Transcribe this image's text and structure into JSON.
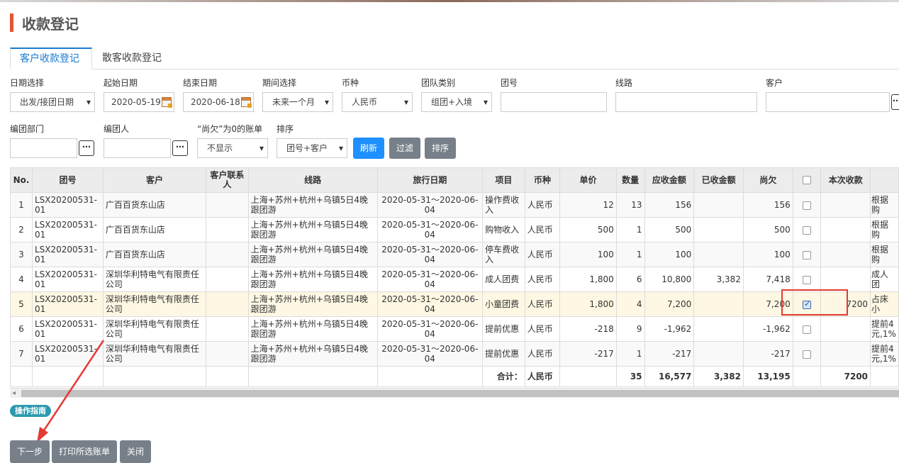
{
  "page": {
    "title": "收款登记"
  },
  "tabs": [
    {
      "label": "客户收款登记"
    },
    {
      "label": "散客收款登记"
    }
  ],
  "filters": {
    "date_select": {
      "label": "日期选择",
      "value": "出发/接团日期"
    },
    "start_date": {
      "label": "起始日期",
      "value": "2020-05-19"
    },
    "end_date": {
      "label": "结束日期",
      "value": "2020-06-18"
    },
    "period": {
      "label": "期间选择",
      "value": "未来一个月"
    },
    "currency": {
      "label": "币种",
      "value": "人民币"
    },
    "team_type": {
      "label": "团队类别",
      "value": "组团+入境"
    },
    "team_no": {
      "label": "团号",
      "value": ""
    },
    "route": {
      "label": "线路",
      "value": ""
    },
    "customer": {
      "label": "客户",
      "value": ""
    },
    "dept": {
      "label": "编团部门",
      "value": ""
    },
    "creator": {
      "label": "编团人",
      "value": ""
    },
    "owed_zero": {
      "label": "“尚欠”为0的账单",
      "value": "不显示"
    },
    "sort": {
      "label": "排序",
      "value": "团号+客户"
    },
    "more_icon": "⋯"
  },
  "buttons": {
    "refresh": "刷新",
    "filter": "过滤",
    "sort": "排序"
  },
  "table": {
    "headers": {
      "no": "No.",
      "team": "团号",
      "customer": "客户",
      "contact": "客户联系人",
      "route": "线路",
      "date": "旅行日期",
      "item": "项目",
      "currency": "币种",
      "price": "单价",
      "qty": "数量",
      "due": "应收金额",
      "received": "已收金额",
      "owed": "尚欠",
      "check": "",
      "this_pay": "本次收款",
      "extra": ""
    },
    "rows": [
      {
        "no": "1",
        "team": "LSX20200531-01",
        "customer": "广百百货东山店",
        "contact": "",
        "route": "上海+苏州+杭州+乌镇5日4晚跟团游",
        "date": "2020-05-31～2020-06-04",
        "item": "操作费收入",
        "currency": "人民币",
        "price": "12",
        "qty": "13",
        "due": "156",
        "received": "",
        "owed": "156",
        "checked": false,
        "this_pay": "",
        "extra": "根据购"
      },
      {
        "no": "2",
        "team": "LSX20200531-01",
        "customer": "广百百货东山店",
        "contact": "",
        "route": "上海+苏州+杭州+乌镇5日4晚跟团游",
        "date": "2020-05-31～2020-06-04",
        "item": "购物收入",
        "currency": "人民币",
        "price": "500",
        "qty": "1",
        "due": "500",
        "received": "",
        "owed": "500",
        "checked": false,
        "this_pay": "",
        "extra": "根据购"
      },
      {
        "no": "3",
        "team": "LSX20200531-01",
        "customer": "广百百货东山店",
        "contact": "",
        "route": "上海+苏州+杭州+乌镇5日4晚跟团游",
        "date": "2020-05-31～2020-06-04",
        "item": "停车费收入",
        "currency": "人民币",
        "price": "100",
        "qty": "1",
        "due": "100",
        "received": "",
        "owed": "100",
        "checked": false,
        "this_pay": "",
        "extra": "根据购"
      },
      {
        "no": "4",
        "team": "LSX20200531-01",
        "customer": "深圳华利特电气有限责任公司",
        "contact": "",
        "route": "上海+苏州+杭州+乌镇5日4晚跟团游",
        "date": "2020-05-31～2020-06-04",
        "item": "成人团费",
        "currency": "人民币",
        "price": "1,800",
        "qty": "6",
        "due": "10,800",
        "received": "3,382",
        "owed": "7,418",
        "checked": false,
        "this_pay": "",
        "extra": "成人团"
      },
      {
        "no": "5",
        "team": "LSX20200531-01",
        "customer": "深圳华利特电气有限责任公司",
        "contact": "",
        "route": "上海+苏州+杭州+乌镇5日4晚跟团游",
        "date": "2020-05-31～2020-06-04",
        "item": "小童团费",
        "currency": "人民币",
        "price": "1,800",
        "qty": "4",
        "due": "7,200",
        "received": "",
        "owed": "7,200",
        "checked": true,
        "this_pay": "7200",
        "extra": "占床小"
      },
      {
        "no": "6",
        "team": "LSX20200531-01",
        "customer": "深圳华利特电气有限责任公司",
        "contact": "",
        "route": "上海+苏州+杭州+乌镇5日4晚跟团游",
        "date": "2020-05-31～2020-06-04",
        "item": "提前优惠",
        "currency": "人民币",
        "price": "-218",
        "qty": "9",
        "due": "-1,962",
        "received": "",
        "owed": "-1,962",
        "checked": false,
        "this_pay": "",
        "extra": "提前4元,1%"
      },
      {
        "no": "7",
        "team": "LSX20200531-01",
        "customer": "深圳华利特电气有限责任公司",
        "contact": "",
        "route": "上海+苏州+杭州+乌镇5日4晚跟团游",
        "date": "2020-05-31～2020-06-04",
        "item": "提前优惠",
        "currency": "人民币",
        "price": "-217",
        "qty": "1",
        "due": "-217",
        "received": "",
        "owed": "-217",
        "checked": false,
        "this_pay": "",
        "extra": "提前4元,1%"
      }
    ],
    "total": {
      "label": "合计：",
      "currency": "人民币",
      "qty": "35",
      "due": "16,577",
      "received": "3,382",
      "owed": "13,195",
      "this_pay": "7200"
    }
  },
  "guide": "操作指南",
  "footer": {
    "next": "下一步",
    "print": "打印所选账单",
    "close": "关闭"
  },
  "colors": {
    "accent": "#1a7bd1",
    "title_bar": "#e8532f",
    "highlight_box": "#e53935",
    "refresh_button": "#1e90ff",
    "gray_button": "#778089"
  }
}
